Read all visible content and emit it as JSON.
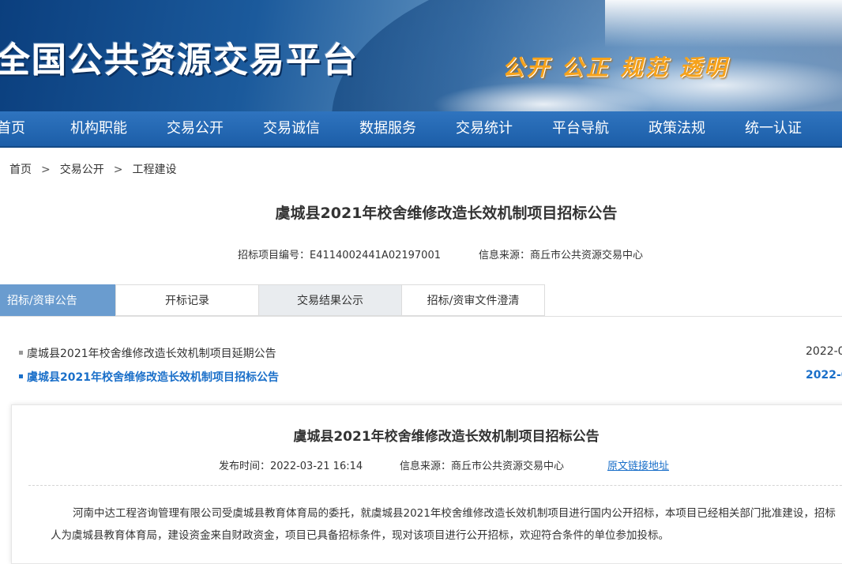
{
  "header": {
    "site_title": "全国公共资源交易平台",
    "slogan": "公开  公正  规范  透明"
  },
  "nav": {
    "items": [
      "首页",
      "机构职能",
      "交易公开",
      "交易诚信",
      "数据服务",
      "交易统计",
      "平台导航",
      "政策法规",
      "统一认证"
    ]
  },
  "breadcrumb": {
    "items": [
      "首页",
      "交易公开",
      "工程建设"
    ],
    "separator": ">"
  },
  "notice": {
    "title": "虞城县2021年校舍维修改造长效机制项目招标公告",
    "project_code": "招标项目编号：E4114002441A02197001",
    "source": "信息来源：商丘市公共资源交易中心"
  },
  "tabs": [
    "招标/资审公告",
    "开标记录",
    "交易结果公示",
    "招标/资审文件澄清"
  ],
  "list": [
    {
      "label": "虞城县2021年校舍维修改造长效机制项目延期公告",
      "date": "2022-0",
      "active": false
    },
    {
      "label": "虞城县2021年校舍维修改造长效机制项目招标公告",
      "date": "2022-0",
      "active": true
    }
  ],
  "detail": {
    "title": "虞城县2021年校舍维修改造长效机制项目招标公告",
    "publish_time": "发布时间：2022-03-21 16:14",
    "source": "信息来源：商丘市公共资源交易中心",
    "link_label": "原文链接地址",
    "paragraph": "河南中达工程咨询管理有限公司受虞城县教育体育局的委托，就虞城县2021年校舍维修改造长效机制项目进行国内公开招标，本项目已经相关部门批准建设，招标人为虞城县教育体育局，建设资金来自财政资金，项目已具备招标条件，现对该项目进行公开招标，欢迎符合条件的单位参加投标。"
  },
  "colors": {
    "nav_bg": "#1c5ea8",
    "active_tab": "#6a9ccf",
    "link": "#1a6fc9",
    "slogan": "#f6a21a"
  }
}
